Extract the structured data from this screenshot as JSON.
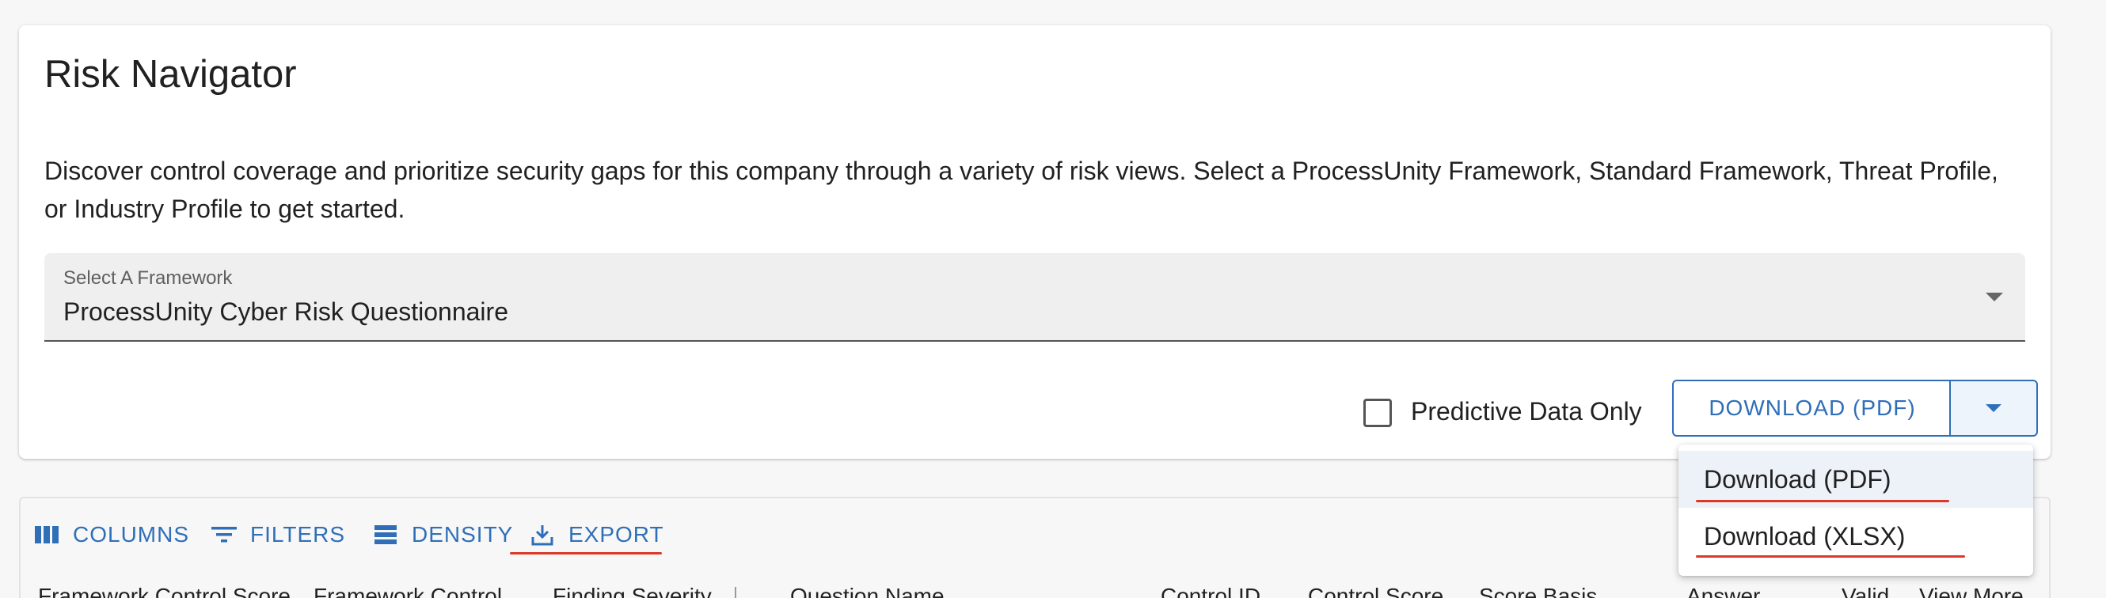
{
  "page": {
    "title": "Risk Navigator",
    "description": "Discover control coverage and prioritize security gaps for this company through a variety of risk views. Select a ProcessUnity Framework, Standard Framework, Threat Profile, or Industry Profile to get started."
  },
  "framework_select": {
    "label": "Select A Framework",
    "value": "ProcessUnity Cyber Risk Questionnaire"
  },
  "predictive": {
    "label": "Predictive Data Only",
    "checked": false
  },
  "download": {
    "main_label": "DOWNLOAD (PDF)",
    "menu": [
      {
        "label": "Download (PDF)"
      },
      {
        "label": "Download (XLSX)"
      }
    ]
  },
  "toolbar": {
    "columns": "COLUMNS",
    "filters": "FILTERS",
    "density": "DENSITY",
    "export": "EXPORT"
  },
  "table": {
    "headers": [
      "Framework Control Score",
      "Framework Control",
      "Finding Severity",
      "Question Name",
      "Control ID",
      "Control Score",
      "Score Basis",
      "Answer",
      "Valid",
      "View More"
    ]
  },
  "colors": {
    "accent": "#2f6fb8",
    "highlight_underline": "#d93a2b"
  }
}
